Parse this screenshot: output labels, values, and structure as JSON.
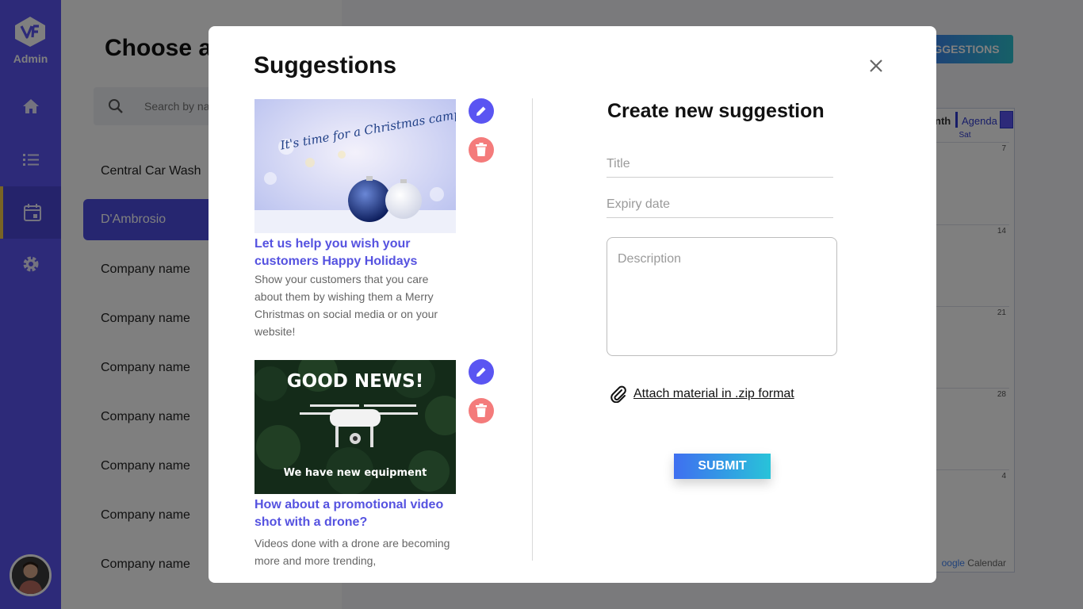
{
  "app": {
    "role_label": "Admin"
  },
  "sidebar": {
    "items": [
      {
        "icon": "home-icon"
      },
      {
        "icon": "list-icon"
      },
      {
        "icon": "calendar-icon",
        "active": true
      },
      {
        "icon": "gear-icon"
      }
    ]
  },
  "main": {
    "title": "Choose a",
    "search_placeholder": "Search by na",
    "companies": [
      "Central Car Wash",
      "D'Ambrosio",
      "Company name",
      "Company name",
      "Company name",
      "Company name",
      "Company name",
      "Company name",
      "Company name"
    ],
    "active_company_index": 1,
    "top_button_label": "GGESTIONS",
    "calendar": {
      "view_month": "nth",
      "view_agenda": "Agenda",
      "weekday": "Sat",
      "dates": [
        "7",
        "14",
        "21",
        "28",
        "4"
      ],
      "footer_brand": "oogle",
      "footer_label": " Calendar"
    }
  },
  "modal": {
    "title": "Suggestions",
    "suggestions": [
      {
        "image_caption": "It's time for a Christmas campaign!",
        "title": "Let us help you wish your customers Happy Holidays",
        "description": "Show your customers that you care about them by wishing them a Merry Christmas on social media or on your website!"
      },
      {
        "image_heading": "GOOD NEWS!",
        "image_caption": "We have new equipment",
        "title": "How about a promotional video shot with a drone?",
        "description": "Videos done with a drone are becoming more and more trending,"
      }
    ],
    "form": {
      "heading": "Create new suggestion",
      "title_placeholder": "Title",
      "expiry_placeholder": "Expiry date",
      "description_placeholder": "Description",
      "attach_label": "Attach material in .zip format",
      "submit_label": "SUBMIT"
    }
  },
  "colors": {
    "sidebar": "#5a55f2",
    "accent_title": "#5552e0",
    "edit": "#5a55f2",
    "delete": "#f47b7b"
  }
}
